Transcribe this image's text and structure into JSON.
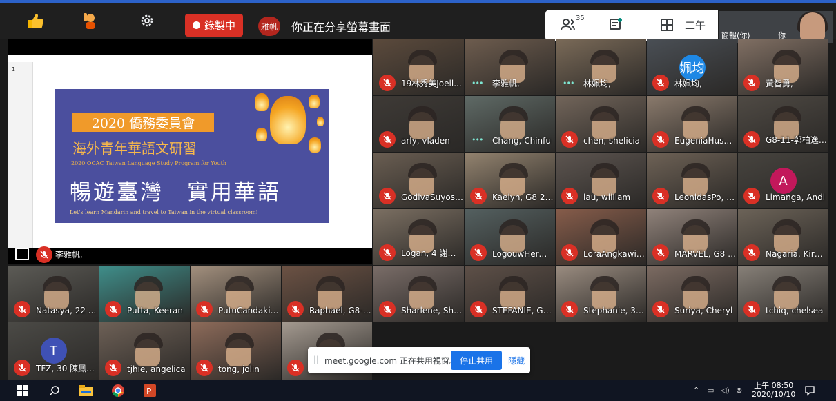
{
  "toolbar": {
    "recording_label": "錄製中",
    "presenter_avatar": "雅帆",
    "presenting_text": "你正在分享螢幕畫面",
    "participants_count": "35",
    "time_fragment": "二午",
    "self_label": "簡報(你)",
    "self_short": "你"
  },
  "presentation": {
    "slide_number": "1",
    "banner": "2020 僑務委員會",
    "subtitle": "海外青年華語文研習",
    "english_program": "2020 OCAC Taiwan Language Study Program for Youth",
    "big_title": "暢遊臺灣　實用華語",
    "english_tagline": "Let's learn Mandarin and travel to Taiwan in the virtual classroom!",
    "presenter_name": "李雅帆,"
  },
  "tiles": [
    {
      "name": "19林秀美Joell...",
      "state": "muted"
    },
    {
      "name": "李雅帆,",
      "state": "speaking"
    },
    {
      "name": "林姵均,",
      "state": "speaking"
    },
    {
      "name": "林姵均,",
      "state": "muted",
      "avatar": "姵均",
      "avatar_color": "#1e88e5"
    },
    {
      "name": "黃智勇,",
      "state": "muted"
    },
    {
      "name": "arly, vladen",
      "state": "muted"
    },
    {
      "name": "Chang, Chinfu",
      "state": "speaking"
    },
    {
      "name": "chen, shelicia",
      "state": "muted"
    },
    {
      "name": "EugeniaHusa...",
      "state": "muted"
    },
    {
      "name": "G8-11-郭柏逸-...",
      "state": "muted"
    },
    {
      "name": "GodivaSuyoso...",
      "state": "muted"
    },
    {
      "name": "Kaelyn, G8 26 ...",
      "state": "muted"
    },
    {
      "name": "lau, william",
      "state": "muted"
    },
    {
      "name": "LeonidasPo, A...",
      "state": "muted"
    },
    {
      "name": "Limanga, Andi",
      "state": "muted",
      "avatar": "A",
      "avatar_color": "#c2185b"
    },
    {
      "name": "Logan, 4 謝志明",
      "state": "muted"
    },
    {
      "name": "LogouwHerm...",
      "state": "muted"
    },
    {
      "name": "LoraAngkawij...",
      "state": "muted"
    },
    {
      "name": "MARVEL, G8 0...",
      "state": "muted"
    },
    {
      "name": "Nagaria, Kirana",
      "state": "muted"
    },
    {
      "name": "Natasya, 22 ...",
      "state": "muted"
    },
    {
      "name": "Putta, Keeran",
      "state": "muted"
    },
    {
      "name": "PutuCandakir...",
      "state": "muted"
    },
    {
      "name": "Raphael, G8-1...",
      "state": "muted"
    },
    {
      "name": "Sharlene, Shar...",
      "state": "muted"
    },
    {
      "name": "STEFANIE, G8 ...",
      "state": "muted"
    },
    {
      "name": "Stephanie, 31 ...",
      "state": "muted"
    },
    {
      "name": "Suriya, Cheryl",
      "state": "muted"
    },
    {
      "name": "tchiq, chelsea",
      "state": "muted"
    },
    {
      "name": "TFZ, 30 陳鳳...",
      "state": "muted",
      "avatar": "T",
      "avatar_color": "#3f51b5"
    },
    {
      "name": "tjhie, angelica",
      "state": "muted"
    },
    {
      "name": "tong, jolin",
      "state": "muted"
    },
    {
      "name": "",
      "state": "muted"
    }
  ],
  "share_popup": {
    "message": "meet.google.com 正在共用視窗。",
    "stop_label": "停止共用",
    "hide_label": "隱藏"
  },
  "taskbar": {
    "time": "上午 08:50",
    "date": "2020/10/10"
  },
  "icons": [
    "thumbs-up-icon",
    "raise-hand-icon",
    "settings-icon",
    "people-icon",
    "chat-icon",
    "grid-icon",
    "mic-off-icon",
    "windows-start-icon",
    "search-icon",
    "file-explorer-icon",
    "chrome-icon",
    "powerpoint-icon",
    "notification-icon"
  ]
}
